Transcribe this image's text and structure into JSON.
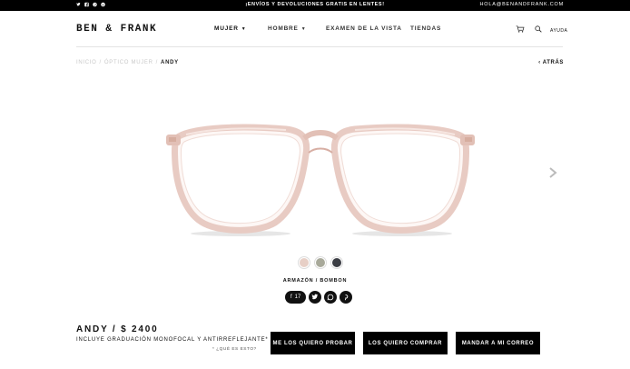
{
  "topbar": {
    "social_icons": [
      "twitter-icon",
      "facebook-icon",
      "pinterest-icon",
      "google-plus-icon"
    ],
    "promo": "¡ENVÍOS Y DEVOLUCIONES GRATIS EN LENTES!",
    "email": "HOLA@BENANDFRANK.COM"
  },
  "header": {
    "logo": "BEN & FRANK",
    "nav": [
      {
        "label": "MUJER",
        "caret": "▼"
      },
      {
        "label": "HOMBRE",
        "caret": "▼"
      },
      {
        "label": "EXAMEN DE LA VISTA"
      },
      {
        "label": "TIENDAS"
      }
    ],
    "help": "AYUDA"
  },
  "breadcrumb": {
    "items": [
      "INICIO",
      "/",
      "ÓPTICO MUJER",
      "/"
    ],
    "current": "ANDY",
    "back": "ATRÁS"
  },
  "product": {
    "colors": {
      "frame": "#e8cbc3",
      "frame_dark": "#d7aea3",
      "temple": "#c98d63"
    },
    "swatches": [
      {
        "name": "bombon",
        "color": "#e7cfc6"
      },
      {
        "name": "olive",
        "color": "#a8a99a"
      },
      {
        "name": "dark",
        "color": "#3b3d44"
      }
    ],
    "frame_label": "ARMAZÓN / BOMBON",
    "share": {
      "facebook_count": "17"
    },
    "title": "ANDY / $ 2400",
    "description": "INCLUYE GRADUACIÓN MONOFOCAL Y ANTIRREFLEJANTE*",
    "faq": "* ¿QUÉ ES ESTO?",
    "buttons": {
      "try": "ME LOS QUIERO PROBAR",
      "buy": "LOS QUIERO COMPRAR",
      "mail": "MANDAR A MI CORREO"
    }
  }
}
